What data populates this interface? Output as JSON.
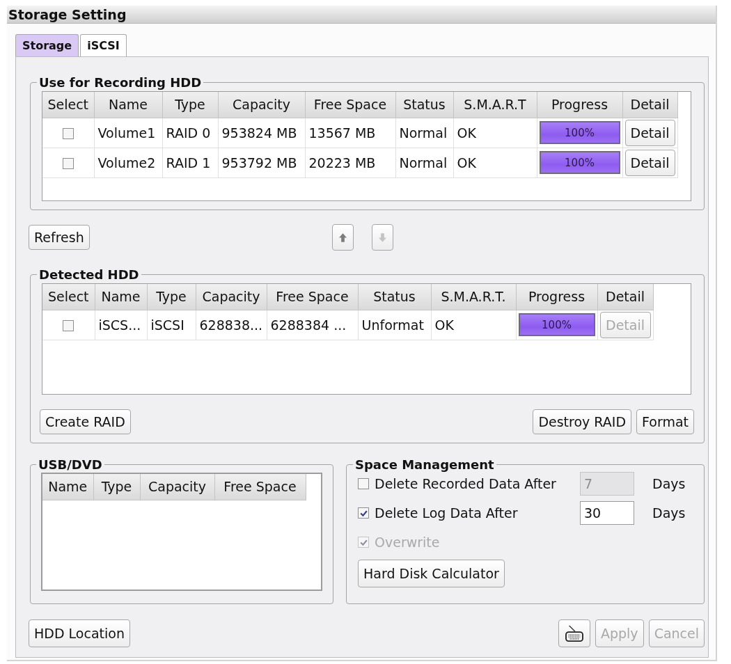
{
  "window": {
    "title": "Storage Setting"
  },
  "tabs": [
    {
      "label": "Storage",
      "selected": true
    },
    {
      "label": "iSCSI",
      "selected": false
    }
  ],
  "recording_hdd": {
    "title": "Use for Recording HDD",
    "columns": [
      "Select",
      "Name",
      "Type",
      "Capacity",
      "Free Space",
      "Status",
      "S.M.A.R.T",
      "Progress",
      "Detail"
    ],
    "rows": [
      {
        "cells": [
          {
            "kind": "checkbox",
            "checked": false
          },
          "Volume1",
          "RAID 0",
          "953824 MB",
          "13567 MB",
          "Normal",
          "OK",
          {
            "kind": "progress",
            "level": 1,
            "label": "100%"
          },
          {
            "kind": "button",
            "label": "Detail",
            "disabled": false
          }
        ]
      },
      {
        "cells": [
          {
            "kind": "checkbox",
            "checked": false
          },
          "Volume2",
          "RAID 1",
          "953792 MB",
          "20223 MB",
          "Normal",
          "OK",
          {
            "kind": "progress",
            "level": 1,
            "label": "100%"
          },
          {
            "kind": "button",
            "label": "Detail",
            "disabled": false
          }
        ]
      }
    ]
  },
  "refresh_button": {
    "label": "Refresh"
  },
  "move_buttons": [
    {
      "kind": "up",
      "disabled": false
    },
    {
      "kind": "down",
      "disabled": true
    }
  ],
  "detected_hdd": {
    "title": "Detected HDD",
    "columns": [
      "Select",
      "Name",
      "Type",
      "Capacity",
      "Free Space",
      "Status",
      "S.M.A.R.T.",
      "Progress",
      "Detail"
    ],
    "rows": [
      {
        "cells": [
          {
            "kind": "checkbox",
            "checked": false
          },
          "iSCS...",
          "iSCSI",
          "628838...",
          "6288384 ...",
          "Unformat",
          "OK",
          {
            "kind": "progress",
            "level": 1,
            "label": "100%"
          },
          {
            "kind": "button",
            "label": "Detail",
            "disabled": true
          }
        ]
      }
    ],
    "left_buttons": [
      {
        "label": "Create RAID"
      }
    ],
    "right_buttons": [
      {
        "label": "Destroy RAID"
      },
      {
        "label": "Format"
      }
    ]
  },
  "usb_dvd": {
    "title": "USB/DVD",
    "columns": [
      "Name",
      "Type",
      "Capacity",
      "Free Space"
    ]
  },
  "space_management": {
    "title": "Space Management",
    "rows": [
      {
        "kind": "field",
        "label": "Delete Recorded Data After",
        "checked": false,
        "disabled": false,
        "field": {
          "value": "7",
          "disabled": true
        },
        "unit": "Days"
      },
      {
        "kind": "field",
        "label": "Delete Log Data After",
        "checked": true,
        "disabled": false,
        "field": {
          "value": "30",
          "disabled": false
        },
        "unit": "Days"
      },
      {
        "kind": "checkbox",
        "label": "Overwrite",
        "checked": true,
        "disabled": true
      }
    ],
    "button": {
      "label": "Hard Disk Calculator"
    }
  },
  "footer": {
    "left_button": {
      "label": "HDD Location"
    },
    "buttons": [
      {
        "kind": "keyboard",
        "disabled": false
      },
      {
        "kind": "text",
        "label": "Apply",
        "disabled": true
      },
      {
        "kind": "text",
        "label": "Cancel",
        "disabled": true
      }
    ]
  }
}
